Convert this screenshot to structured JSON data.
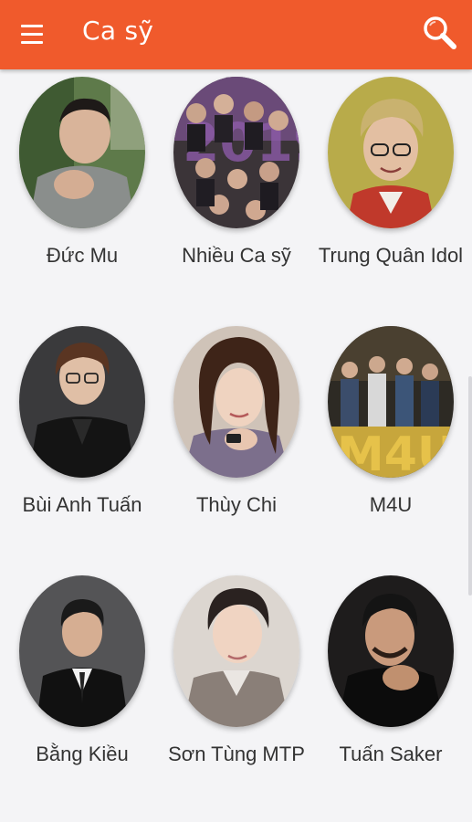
{
  "app_bar": {
    "title": "Ca sỹ",
    "menu_icon": "hamburger-menu-icon",
    "search_icon": "search-icon",
    "color": "#f05a2c"
  },
  "artists": [
    {
      "name": "Đức Mu",
      "photo": "singer-photo"
    },
    {
      "name": "Nhiều Ca sỹ",
      "photo": "group-collage-photo"
    },
    {
      "name": "Trung Quân Idol",
      "photo": "singer-photo"
    },
    {
      "name": "Bùi Anh Tuấn",
      "photo": "singer-photo"
    },
    {
      "name": "Thùy Chi",
      "photo": "singer-photo"
    },
    {
      "name": "M4U",
      "photo": "group-photo"
    },
    {
      "name": "Bằng Kiều",
      "photo": "singer-photo"
    },
    {
      "name": "Sơn Tùng MTP",
      "photo": "singer-photo"
    },
    {
      "name": "Tuấn Saker",
      "photo": "singer-photo"
    }
  ]
}
